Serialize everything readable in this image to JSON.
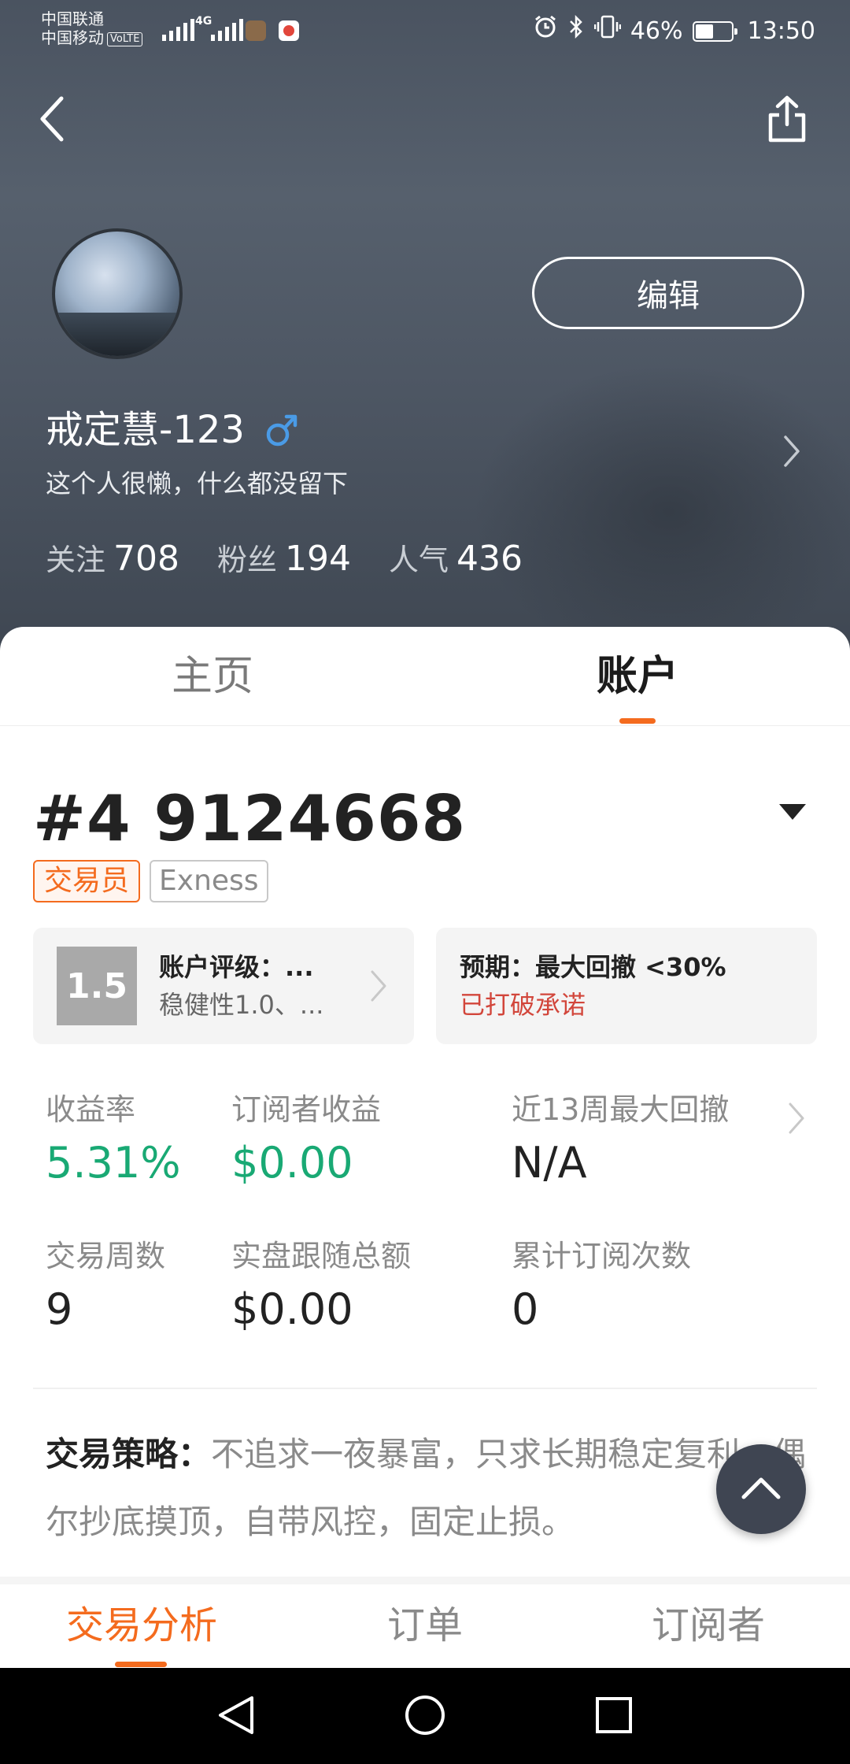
{
  "status_bar": {
    "carrier_1": "中国联通",
    "carrier_2": "中国移动",
    "volte": "VoLTE",
    "network": "4G",
    "battery_percent": "46%",
    "time": "13:50"
  },
  "profile": {
    "edit_label": "编辑",
    "username": "戒定慧-123",
    "bio": "这个人很懒，什么都没留下",
    "stats": [
      {
        "label": "关注",
        "value": "708"
      },
      {
        "label": "粉丝",
        "value": "194"
      },
      {
        "label": "人气",
        "value": "436"
      }
    ]
  },
  "tabs": {
    "home": "主页",
    "account": "账户",
    "active": "account"
  },
  "account": {
    "number": "#4 9124668",
    "badges": {
      "trader": "交易员",
      "broker": "Exness"
    },
    "rating": {
      "score": "1.5",
      "title": "账户评级：...",
      "subtitle": "稳健性1.0、..."
    },
    "expectation": {
      "title": "预期：最大回撤 <30%",
      "status": "已打破承诺"
    },
    "metrics": {
      "return_rate": {
        "label": "收益率",
        "value": "5.31%"
      },
      "subscriber_income": {
        "label": "订阅者收益",
        "value": "$0.00"
      },
      "max_drawdown": {
        "label": "近13周最大回撤",
        "value": "N/A"
      },
      "trading_weeks": {
        "label": "交易周数",
        "value": "9"
      },
      "follow_amount": {
        "label": "实盘跟随总额",
        "value": "$0.00"
      },
      "subscription_count": {
        "label": "累计订阅次数",
        "value": "0"
      }
    },
    "strategy": {
      "label": "交易策略：",
      "text": "不追求一夜暴富，只求长期稳定复利，偶尔抄底摸顶，自带风控，固定止损。"
    }
  },
  "sub_tabs": {
    "analysis": "交易分析",
    "orders": "订单",
    "subscribers": "订阅者",
    "active": "analysis"
  },
  "colors": {
    "accent": "#f46b1e",
    "positive": "#19a974",
    "warning": "#d2463b",
    "header_bg": "#4f5865"
  },
  "icons": [
    "back-arrow-icon",
    "share-icon",
    "male-icon",
    "chevron-right-icon",
    "caret-down-icon",
    "arrow-up-icon",
    "nav-back-icon",
    "nav-home-icon",
    "nav-recents-icon"
  ]
}
